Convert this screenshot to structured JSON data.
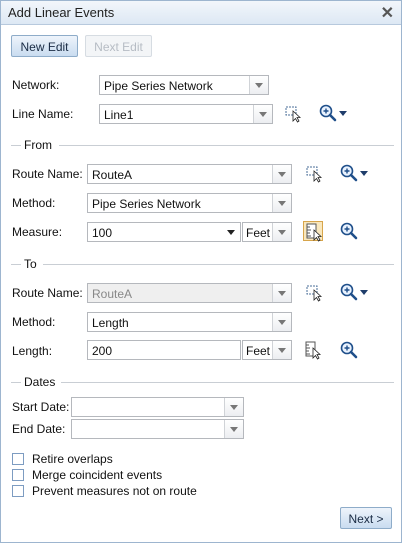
{
  "window": {
    "title": "Add Linear Events"
  },
  "toolbar": {
    "new_edit": "New Edit",
    "next_edit": "Next Edit"
  },
  "network": {
    "label": "Network:",
    "value": "Pipe Series Network"
  },
  "line_name": {
    "label": "Line Name:",
    "value": "Line1"
  },
  "from": {
    "heading": "From",
    "route_label": "Route Name:",
    "route_value": "RouteA",
    "method_label": "Method:",
    "method_value": "Pipe Series Network",
    "measure_label": "Measure:",
    "measure_value": "100",
    "unit": "Feet"
  },
  "to": {
    "heading": "To",
    "route_label": "Route Name:",
    "route_value": "RouteA",
    "method_label": "Method:",
    "method_value": "Length",
    "length_label": "Length:",
    "length_value": "200",
    "unit": "Feet"
  },
  "dates": {
    "heading": "Dates",
    "start_label": "Start Date:",
    "start_value": "",
    "end_label": "End Date:",
    "end_value": ""
  },
  "options": {
    "retire_overlaps": "Retire overlaps",
    "merge_coincident": "Merge coincident events",
    "prevent_measures": "Prevent measures not on route"
  },
  "footer": {
    "next": "Next >"
  },
  "icons": {
    "select": "map-select-cursor-icon",
    "zoom": "zoom-magnifier-icon",
    "pick": "pick-measure-icon"
  },
  "colors": {
    "accent": "#c9dcf0",
    "border": "#9db5cf",
    "selected_bg": "#f9e7bd"
  }
}
